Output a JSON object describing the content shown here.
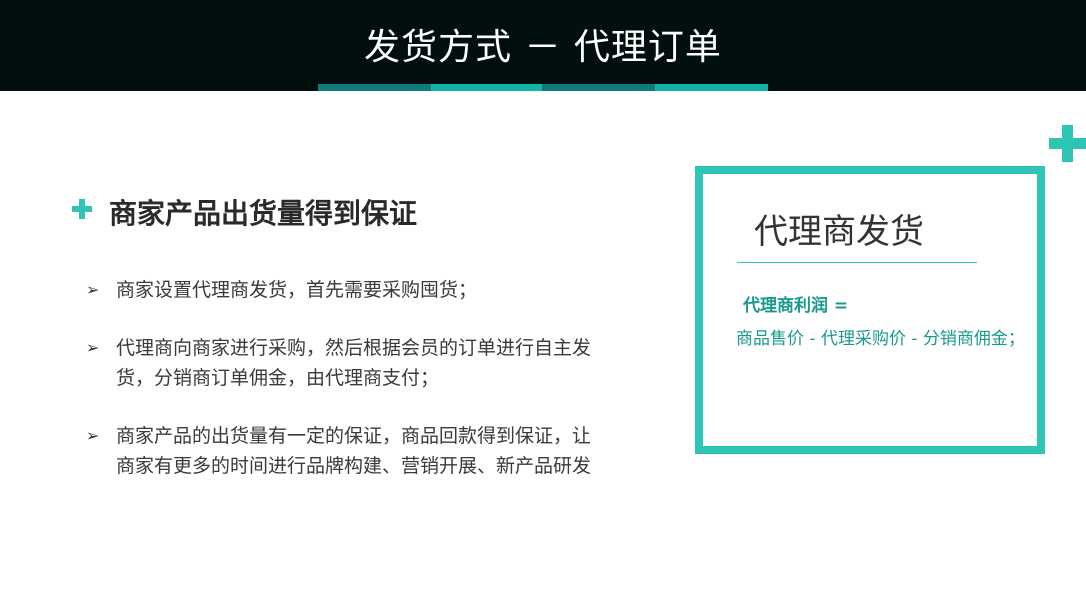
{
  "header": {
    "title": "发货方式 － 代理订单",
    "background": "#020f0f",
    "accent_colors": [
      "#0e7c78",
      "#13b5a8"
    ]
  },
  "section": {
    "heading": "商家产品出货量得到保证",
    "icon": "plus-icon",
    "bullet_icon": "arrowhead-bullet-icon",
    "bullet_marker": "➢",
    "bullets": [
      "商家设置代理商发货，首先需要采购囤货；",
      "代理商向商家进行采购，然后根据会员的订单进行自主发货，分销商订单佣金，由代理商支付；",
      "商家产品的出货量有一定的保证，商品回款得到保证，让商家有更多的时间进行品牌构建、营销开展、新产品研发"
    ]
  },
  "box": {
    "title": "代理商发货",
    "formula_label": "代理商利润  =",
    "formula": "商品售价 - 代理采购价 - 分销商佣金；",
    "border_color": "#2ec4b6",
    "text_color": "#1a9a8c"
  },
  "decor": {
    "corner_icon": "plus-icon",
    "accent": "#2ec4b6"
  }
}
